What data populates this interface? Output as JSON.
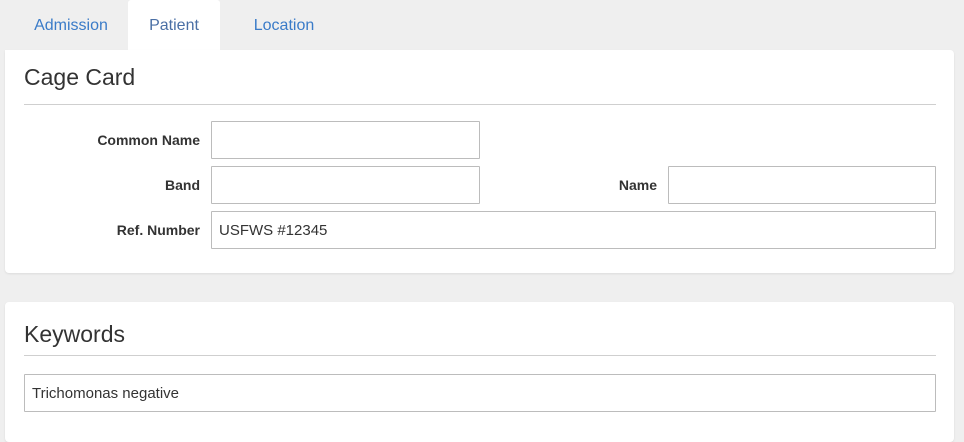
{
  "tabs": [
    {
      "label": "Admission",
      "active": false
    },
    {
      "label": "Patient",
      "active": true
    },
    {
      "label": "Location",
      "active": false
    }
  ],
  "cage_card": {
    "title": "Cage Card",
    "fields": {
      "common_name": {
        "label": "Common Name",
        "value": ""
      },
      "band": {
        "label": "Band",
        "value": ""
      },
      "name": {
        "label": "Name",
        "value": ""
      },
      "ref_number": {
        "label": "Ref. Number",
        "value": "USFWS #12345"
      }
    }
  },
  "keywords": {
    "title": "Keywords",
    "value": "Trichomonas negative"
  },
  "colors": {
    "tab_link": "#3a7bc8",
    "background": "#efefef",
    "card": "#ffffff",
    "border": "#bcbcbc"
  }
}
